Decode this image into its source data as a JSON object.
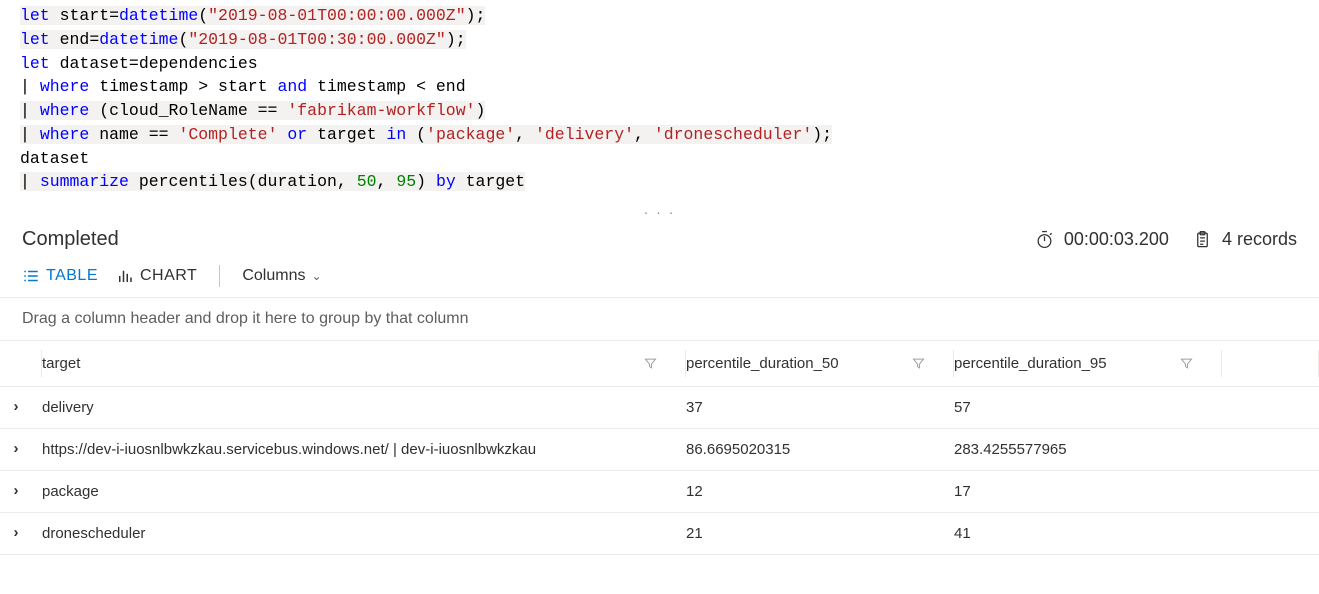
{
  "query": {
    "tokens": [
      [
        {
          "t": "kw",
          "v": "let"
        },
        {
          "t": "txt",
          "v": " start="
        },
        {
          "t": "fn",
          "v": "datetime"
        },
        {
          "t": "txt",
          "v": "("
        },
        {
          "t": "str",
          "v": "\"2019-08-01T00:00:00.000Z\""
        },
        {
          "t": "txt",
          "v": ");"
        }
      ],
      [
        {
          "t": "kw",
          "v": "let"
        },
        {
          "t": "txt",
          "v": " end="
        },
        {
          "t": "fn",
          "v": "datetime"
        },
        {
          "t": "txt",
          "v": "("
        },
        {
          "t": "str",
          "v": "\"2019-08-01T00:30:00.000Z\""
        },
        {
          "t": "txt",
          "v": ");"
        }
      ],
      [
        {
          "t": "kw",
          "v": "let"
        },
        {
          "t": "txt",
          "v": " dataset=dependencies"
        }
      ],
      [
        {
          "t": "txt",
          "v": "| "
        },
        {
          "t": "kw",
          "v": "where"
        },
        {
          "t": "txt",
          "v": " timestamp > start "
        },
        {
          "t": "kw",
          "v": "and"
        },
        {
          "t": "txt",
          "v": " timestamp < end"
        }
      ],
      [
        {
          "t": "txt",
          "v": "| "
        },
        {
          "t": "kw",
          "v": "where"
        },
        {
          "t": "txt",
          "v": " (cloud_RoleName == "
        },
        {
          "t": "str",
          "v": "'fabrikam-workflow'"
        },
        {
          "t": "txt",
          "v": ")"
        }
      ],
      [
        {
          "t": "txt",
          "v": "| "
        },
        {
          "t": "kw",
          "v": "where"
        },
        {
          "t": "txt",
          "v": " name == "
        },
        {
          "t": "str",
          "v": "'Complete'"
        },
        {
          "t": "txt",
          "v": " "
        },
        {
          "t": "kw",
          "v": "or"
        },
        {
          "t": "txt",
          "v": " target "
        },
        {
          "t": "kw",
          "v": "in"
        },
        {
          "t": "txt",
          "v": " ("
        },
        {
          "t": "str",
          "v": "'package'"
        },
        {
          "t": "txt",
          "v": ", "
        },
        {
          "t": "str",
          "v": "'delivery'"
        },
        {
          "t": "txt",
          "v": ", "
        },
        {
          "t": "str",
          "v": "'dronescheduler'"
        },
        {
          "t": "txt",
          "v": ");"
        }
      ],
      [
        {
          "t": "txt",
          "v": "dataset"
        }
      ],
      [
        {
          "t": "txt",
          "v": "| "
        },
        {
          "t": "kw",
          "v": "summarize"
        },
        {
          "t": "txt",
          "v": " percentiles(duration, "
        },
        {
          "t": "num",
          "v": "50"
        },
        {
          "t": "txt",
          "v": ", "
        },
        {
          "t": "num",
          "v": "95"
        },
        {
          "t": "txt",
          "v": ") "
        },
        {
          "t": "kw",
          "v": "by"
        },
        {
          "t": "txt",
          "v": " target"
        }
      ]
    ],
    "highlight_lines": [
      0,
      1,
      4,
      5,
      7
    ]
  },
  "status": {
    "text": "Completed",
    "duration": "00:00:03.200",
    "records": "4 records"
  },
  "toolbar": {
    "table_label": "TABLE",
    "chart_label": "CHART",
    "columns_label": "Columns"
  },
  "group_hint": "Drag a column header and drop it here to group by that column",
  "columns": {
    "target": "target",
    "p50": "percentile_duration_50",
    "p95": "percentile_duration_95"
  },
  "rows": [
    {
      "target": "delivery",
      "p50": "37",
      "p95": "57"
    },
    {
      "target": "https://dev-i-iuosnlbwkzkau.servicebus.windows.net/ | dev-i-iuosnlbwkzkau",
      "p50": "86.6695020315",
      "p95": "283.4255577965"
    },
    {
      "target": "package",
      "p50": "12",
      "p95": "17"
    },
    {
      "target": "dronescheduler",
      "p50": "21",
      "p95": "41"
    }
  ]
}
